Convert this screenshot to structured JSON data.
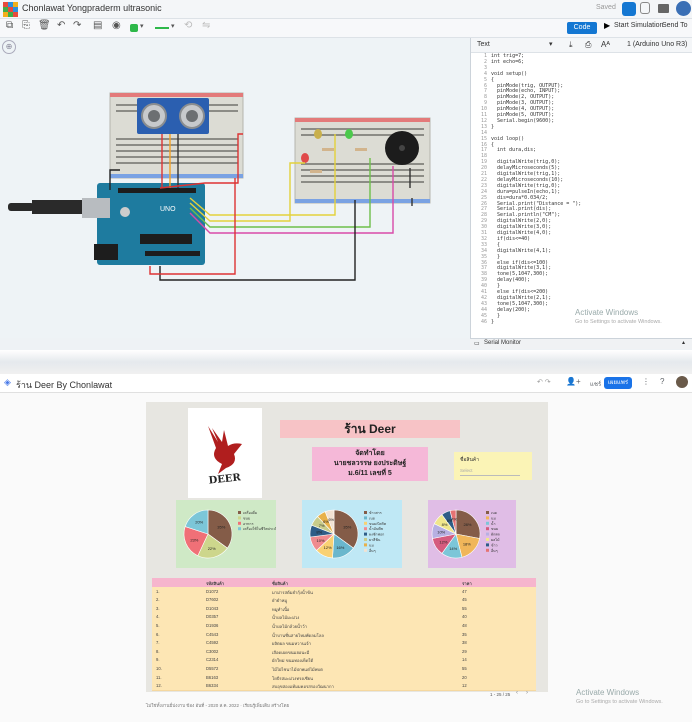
{
  "tinkercad": {
    "project_title": "Chonlawat Yongpraderm ultrasonic",
    "saved_label": "Saved",
    "code_button": "Code",
    "start_simulation": "Start Simulation",
    "send_to": "Send To",
    "code_mode": "Text",
    "board_select": "1 (Arduino Uno R3)",
    "code_lines": [
      "int trig=7;",
      "int echo=6;",
      "",
      "void setup()",
      "{",
      "  pinMode(trig, OUTPUT);",
      "  pinMode(echo, INPUT);",
      "  pinMode(2, OUTPUT);",
      "  pinMode(3, OUTPUT);",
      "  pinMode(4, OUTPUT);",
      "  pinMode(5, OUTPUT);",
      "  Serial.begin(9600);",
      "}",
      "",
      "void loop()",
      "{",
      "  int dura,dis;",
      "",
      "  digitalWrite(trig,0);",
      "  delayMicroseconds(5);",
      "  digitalWrite(trig,1);",
      "  delayMicroseconds(10);",
      "  digitalWrite(trig,0);",
      "  dura=pulseIn(echo,1);",
      "  dis=dura*0.034/2;",
      "  Serial.print(\"Distance = \");",
      "  Serial.print(dis);",
      "  Serial.println(\"CM\");",
      "  digitalWrite(2,0);",
      "  digitalWrite(3,0);",
      "  digitalWrite(4,0);",
      "  if(dis<=40)",
      "  {",
      "  digitalWrite(4,1);",
      "  }",
      "  else if(dis<=100)",
      "  digitalWrite(3,1);",
      "  tone(5,1047,300);",
      "  delay(400);",
      "  }",
      "  else if(dis<=200)",
      "  digitalWrite(2,1);",
      "  tone(5,1047,300);",
      "  delay(200);",
      "  }",
      "}"
    ],
    "serial_monitor": "Serial Monitor",
    "activate_title": "Activate Windows",
    "activate_sub": "Go to Settings to activate Windows."
  },
  "sites": {
    "page_title": "ร้าน Deer By Chonlawat",
    "publish_label": "เผยแพร่",
    "share_label": "แชร์",
    "logo_text": "DEER",
    "shop_title": "ร้าน Deer",
    "author_line1": "จัดทำโดย",
    "author_line2": "นายชลวรรษ ยงประดิษฐ์",
    "author_line3": "ม.6/11 เลขที่ 5",
    "search_label": "ชื่อสินค้า",
    "search_placeholder": "Select",
    "table": {
      "headers": [
        "รหัสสินค้า",
        "ชื่อสินค้า",
        "ราคา"
      ],
      "rows": [
        [
          "1.",
          "D1072",
          "มาม่ารสต้มยำกุ้งน้ำข้น",
          "47"
        ],
        [
          "2.",
          "D7602",
          "ยำยำหมู",
          "45"
        ],
        [
          "3.",
          "D1043",
          "หมูทำเนื้อ",
          "55"
        ],
        [
          "4.",
          "D0357",
          "น้ำผลไม้มะม่วง",
          "40"
        ],
        [
          "5.",
          "D1936",
          "น้ำผลไม้กล้วยน้ำว้า",
          "48"
        ],
        [
          "6.",
          "C4543",
          "น้ำบานชื่นสายไหมพัดลมโลล",
          "35"
        ],
        [
          "7.",
          "C4592",
          "ผลิตผล ขนมหวานเจ้า",
          "38"
        ],
        [
          "8.",
          "C3002",
          "เลือดเผดขนมฮอนะมี",
          "29"
        ],
        [
          "9.",
          "C2314",
          "ผักใหม่ ขนมทองเห็ดใต้",
          "14"
        ],
        [
          "10.",
          "D5572",
          "ไม้ไผ่ไชนาไม้ปกพแต่ไม้พบต",
          "55"
        ],
        [
          "11.",
          "B6163",
          "โยบีรสมะม่วงทรงเซียน",
          "20"
        ],
        [
          "12.",
          "B6334",
          "สบอุขสองแท้มมคอรสรองวัฒนากา",
          "12"
        ]
      ],
      "pagination": "1 - 25 / 25"
    },
    "bottom_note": "ไม่ใช่ทั้งงานมี่ปงงาบ ข้อง อันที่ - 2020 ส.ค. 2022 · เรียนรู้เพิ่มเติม สร้างโดย",
    "activate_title": "Activate Windows",
    "activate_sub": "Go to Settings to activate Windows."
  },
  "chart_data": [
    {
      "type": "pie",
      "title": "",
      "labels": [
        "เครื่องดื่ม",
        "ขนม",
        "อาหาร",
        "เครื่องใช้ในชีวิตประจำวัน"
      ],
      "values": [
        35,
        22,
        23,
        20
      ],
      "colors": [
        "#845c48",
        "#cdd68c",
        "#f07077",
        "#7cc6d8"
      ]
    },
    {
      "type": "pie",
      "title": "",
      "labels": [
        "ข้าวสาร",
        "เนย",
        "ขนม/บิสกิต",
        "น้ำมันพืช",
        "ผงซักฟอก",
        "ยาสีฟัน",
        "นม",
        "อื่นๆ"
      ],
      "values": [
        35,
        16,
        12,
        10,
        8,
        7,
        6,
        6
      ],
      "colors": [
        "#845c48",
        "#6ab7cd",
        "#f9d173",
        "#ef8b8f",
        "#2f5d87",
        "#c9cc8a",
        "#e8b14a",
        "#f2e2d2"
      ]
    },
    {
      "type": "pie",
      "title": "",
      "labels": [
        "เนย",
        "นม",
        "น้ำ",
        "ขนม",
        "ผักสด",
        "ผลไม้",
        "ข้าว",
        "อื่นๆ"
      ],
      "values": [
        28,
        18,
        14,
        12,
        10,
        8,
        6,
        4
      ],
      "colors": [
        "#845c48",
        "#f0b65a",
        "#7cc6d8",
        "#d55b7e",
        "#b7b0e2",
        "#f0e68c",
        "#2f5d87",
        "#e57373"
      ]
    }
  ]
}
